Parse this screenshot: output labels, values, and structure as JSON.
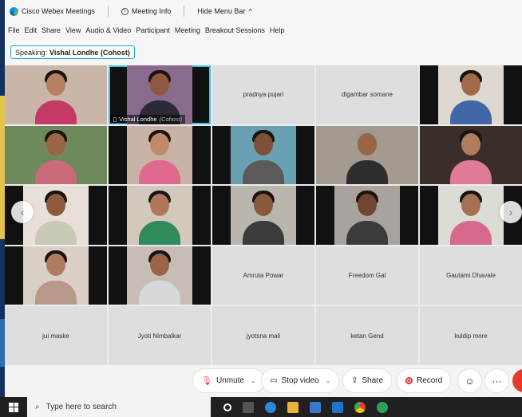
{
  "titlebar": {
    "app_name": "Cisco Webex Meetings",
    "meeting_info": "Meeting Info",
    "hide_menu_bar": "Hide Menu Bar",
    "hide_menu_bar_chevron": "^"
  },
  "menu": {
    "items": [
      "File",
      "Edit",
      "Share",
      "View",
      "Audio & Video",
      "Participant",
      "Meeting",
      "Breakout Sessions",
      "Help"
    ]
  },
  "speaking": {
    "prefix": "Speaking:",
    "name": "Vishal Londhe (Cohost)"
  },
  "participants": {
    "row1": {
      "t3": "pradnya pujari",
      "t4": "digambar somane"
    },
    "active_label_name": "Vishal Londhe",
    "active_label_role": "(Cohost)",
    "row4": {
      "t3": "Amruta Powar",
      "t4": "Freedom Gal",
      "t5": "Gautami Dhavale"
    },
    "row5": {
      "t1": "jui maske",
      "t2": "Jyoti Nimbalkar",
      "t3": "jyotsna mali",
      "t4": "ketan Gend",
      "t5": "kuldip more"
    }
  },
  "nav": {
    "prev": "‹",
    "next": "›"
  },
  "controls": {
    "unmute": "Unmute",
    "stop_video": "Stop video",
    "share": "Share",
    "record": "Record",
    "chevron": "⌄",
    "reactions": "☺",
    "more": "···"
  },
  "taskbar": {
    "search_placeholder": "Type here to search"
  },
  "colors": {
    "accent": "#21a1e8",
    "end_button": "#e5392c",
    "mic_muted": "#e04040"
  }
}
